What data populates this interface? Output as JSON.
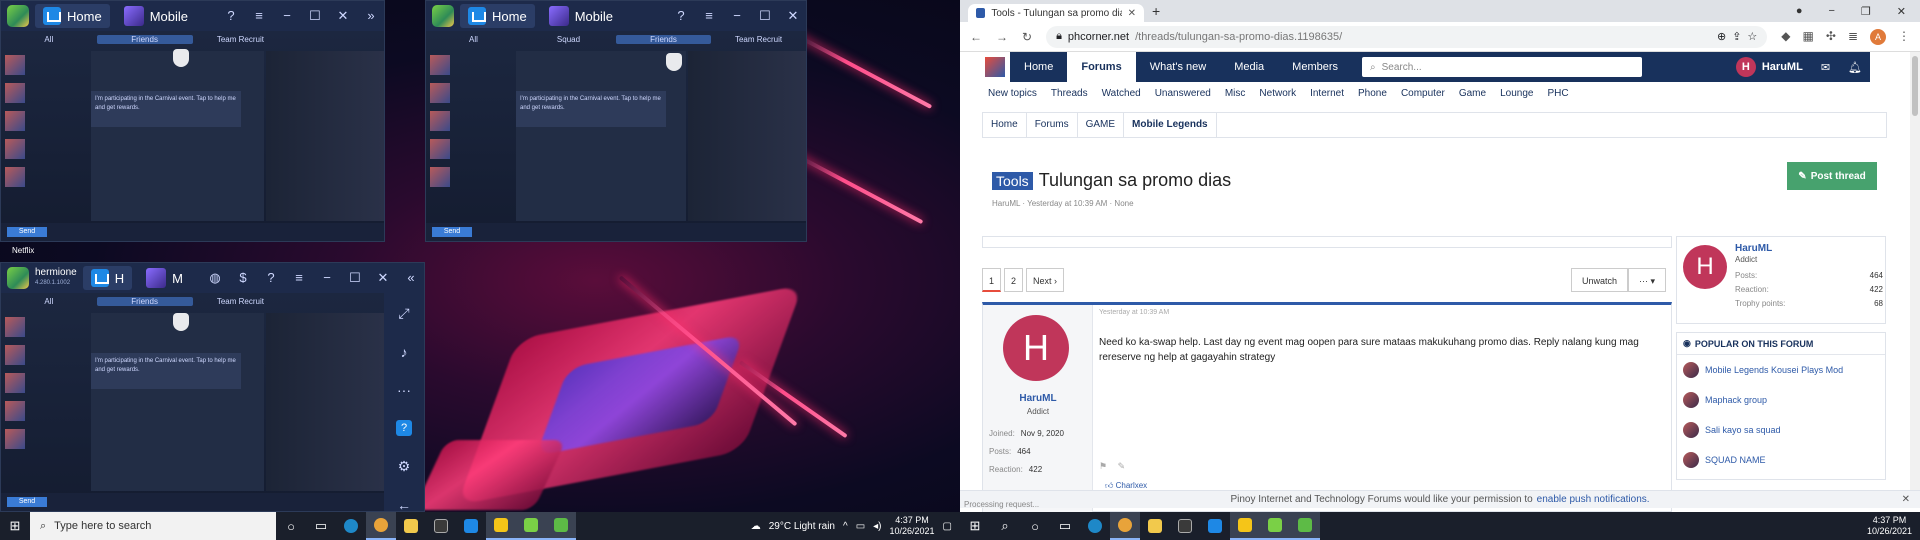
{
  "desktop": {
    "netflix_label": "Netflix"
  },
  "bluestacks_windows": [
    {
      "home_label": "Home",
      "game_tab": "Mobile",
      "tabs": [
        "All",
        "Friends",
        "Team Recruit"
      ],
      "send_label": "Send",
      "chat_message": "I'm participating in the Carnival event. Tap to help me and get rewards."
    },
    {
      "home_label": "Home",
      "game_tab": "Mobile",
      "tabs": [
        "All",
        "Squad",
        "Friends",
        "Team Recruit"
      ],
      "send_label": "Send",
      "chat_message": "I'm participating in the Carnival event. Tap to help me and get rewards."
    },
    {
      "app_name": "hermione",
      "version": "4.280.1.1002",
      "home_label": "H",
      "game_tab": "M",
      "tabs": [
        "All",
        "Friends",
        "Team Recruit"
      ],
      "send_label": "Send",
      "chat_message": "I'm participating in the Carnival event. Tap to help me and get rewards.",
      "side_icons": [
        "expand-icon",
        "volume-icon",
        "more-icon",
        "help-icon",
        "settings-icon",
        "back-icon"
      ]
    }
  ],
  "taskbar_left": {
    "search_placeholder": "Type here to search",
    "weather": "29°C  Light rain",
    "time": "4:37 PM",
    "date": "10/26/2021"
  },
  "browser": {
    "tab_title": "Tools - Tulungan sa promo dias",
    "url_host": "phcorner.net",
    "url_path": "/threads/tulungan-sa-promo-dias.1198635/",
    "avatar_letter": "A"
  },
  "forum": {
    "nav": [
      "Home",
      "Forums",
      "What's new",
      "Media",
      "Members"
    ],
    "search_placeholder": "Search...",
    "username": "HaruML",
    "subnav": [
      "New topics",
      "Threads",
      "Watched",
      "Unanswered",
      "Misc",
      "Network",
      "Internet",
      "Phone",
      "Computer",
      "Game",
      "Lounge",
      "PHC"
    ],
    "breadcrumbs": [
      "Home",
      "Forums",
      "GAME",
      "Mobile Legends"
    ],
    "thread_prefix": "Tools",
    "thread_title": "Tulungan sa promo dias",
    "thread_meta": "HaruML · Yesterday at 10:39 AM · None",
    "post_thread": "Post thread",
    "pages": [
      "1",
      "2",
      "Next ›"
    ],
    "unwatch": "Unwatch",
    "more": "··· ▾",
    "post": {
      "date": "Yesterday at 10:39 AM",
      "avatar_letter": "H",
      "user": "HaruML",
      "title": "Addict",
      "joined_label": "Joined:",
      "joined": "Nov 9, 2020",
      "posts_label": "Posts:",
      "posts": "464",
      "reaction_label": "Reaction:",
      "reaction": "422",
      "body": "Need ko ka-swap help. Last day ng event mag oopen para sure mataas makukuhang promo dias. Reply nalang kung mag rereserve ng help at gagayahin strategy",
      "reactor": "Charlxex"
    },
    "sidebar": {
      "user": "HaruML",
      "title": "Addict",
      "posts_label": "Posts:",
      "posts": "464",
      "reaction_label": "Reaction:",
      "reaction": "422",
      "trophy_label": "Trophy points:",
      "trophy": "68",
      "popular_header": "POPULAR ON THIS FORUM",
      "popular": [
        "Mobile Legends Kousei Plays Mod",
        "Maphack group",
        "Sali kayo sa squad",
        "SQUAD NAME"
      ]
    },
    "push_text": "Pinoy Internet and Technology Forums would like your permission to",
    "push_link": "enable push notifications.",
    "status": "Processing request..."
  },
  "taskbar_right": {
    "time": "4:37 PM",
    "date": "10/26/2021"
  }
}
